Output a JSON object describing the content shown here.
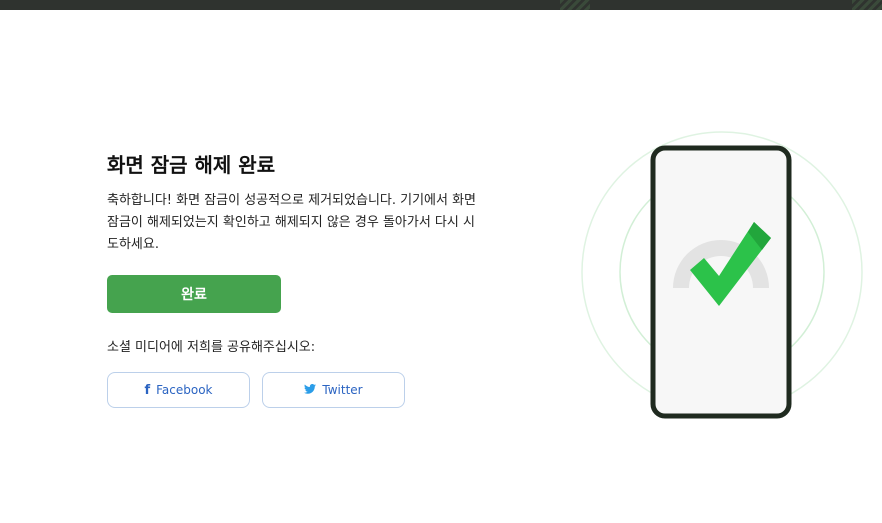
{
  "title": "화면 잠금 해제 완료",
  "description": "축하합니다! 화면 잠금이 성공적으로 제거되었습니다. 기기에서 화면 잠금이 해제되었는지 확인하고 해제되지 않은 경우 돌아가서 다시 시도하세요.",
  "done_button": "완료",
  "share_label": "소셜 미디어에 저희를 공유해주십시오:",
  "social": {
    "facebook": {
      "icon": "f",
      "label": "Facebook"
    },
    "twitter": {
      "icon": "🐦",
      "label": "Twitter"
    }
  },
  "colors": {
    "accent_green": "#45a34e",
    "link_blue": "#2b64c2",
    "phone_frame": "#1f2a1f",
    "check_green": "#2cc24a"
  }
}
